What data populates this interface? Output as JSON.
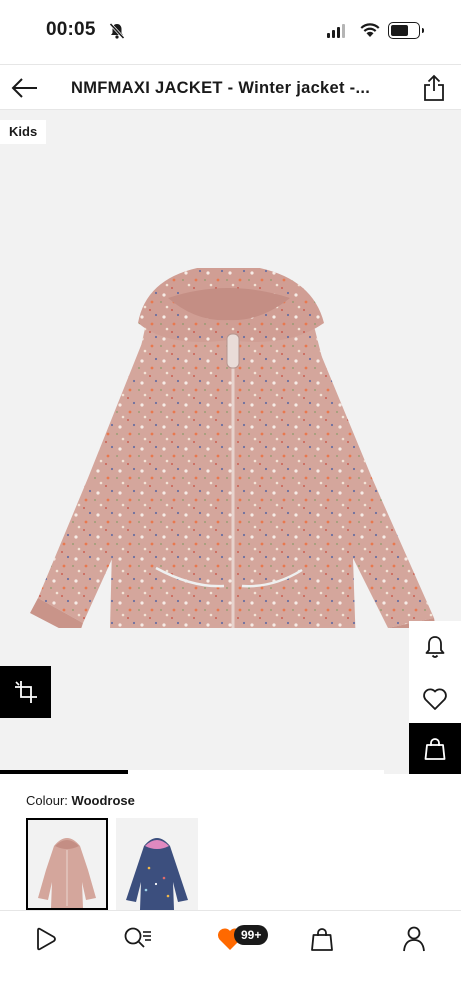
{
  "status_bar": {
    "time": "00:05",
    "icons": [
      "bell-off-icon",
      "cellular-signal-icon",
      "wifi-icon",
      "battery-icon"
    ]
  },
  "header": {
    "title": "NMFMAXI JACKET - Winter jacket -...",
    "back_icon": "arrow-left-icon",
    "share_icon": "share-icon"
  },
  "product_image": {
    "badge": "Kids",
    "background_color": "#f2f2f2",
    "jacket_color": "#d4a69c",
    "gallery_progress_fraction": 0.333
  },
  "actions": {
    "notify_icon": "bell-icon",
    "wishlist_icon": "heart-icon",
    "add_to_bag_icon": "shopping-bag-icon",
    "view_icon": "crop-frame-icon"
  },
  "colour": {
    "label": "Colour:",
    "value": "Woodrose",
    "swatches": [
      {
        "name": "woodrose",
        "color": "#d4a69c",
        "selected": true
      },
      {
        "name": "navy",
        "color": "#3c4f7e",
        "selected": false
      }
    ]
  },
  "bottom_nav": {
    "items": [
      "home-play-icon",
      "search-list-icon",
      "heart-icon",
      "shopping-bag-icon",
      "profile-icon"
    ],
    "wishlist_badge": "99+",
    "accent_color": "#ff6900"
  }
}
